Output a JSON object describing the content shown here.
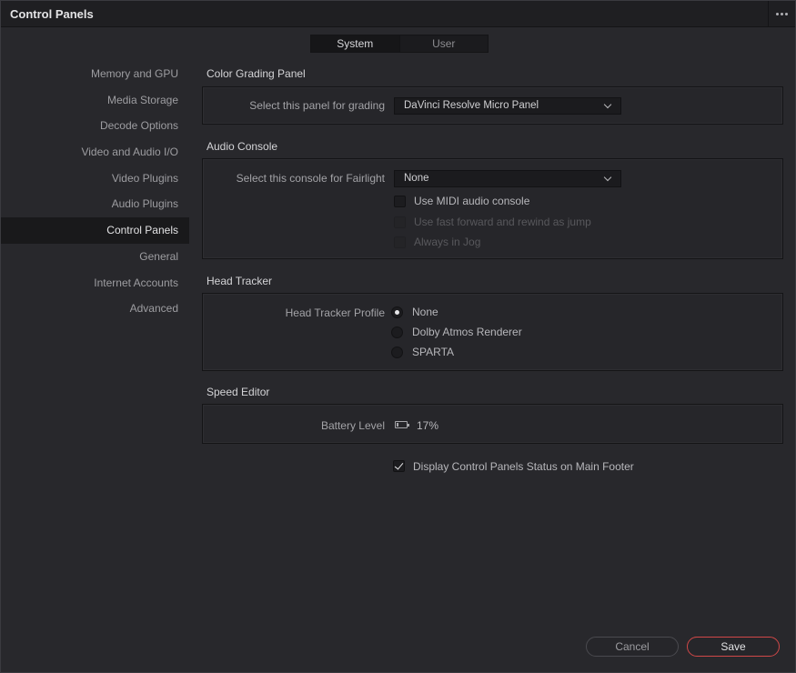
{
  "window": {
    "title": "Control Panels"
  },
  "tabs": [
    {
      "label": "System",
      "active": true
    },
    {
      "label": "User",
      "active": false
    }
  ],
  "sidebar": {
    "items": [
      {
        "label": "Memory and GPU"
      },
      {
        "label": "Media Storage"
      },
      {
        "label": "Decode Options"
      },
      {
        "label": "Video and Audio I/O"
      },
      {
        "label": "Video Plugins"
      },
      {
        "label": "Audio Plugins"
      },
      {
        "label": "Control Panels",
        "active": true
      },
      {
        "label": "General"
      },
      {
        "label": "Internet Accounts"
      },
      {
        "label": "Advanced"
      }
    ]
  },
  "color_grading": {
    "title": "Color Grading Panel",
    "select_label": "Select this panel for grading",
    "select_value": "DaVinci Resolve Micro Panel"
  },
  "audio_console": {
    "title": "Audio Console",
    "select_label": "Select this console for Fairlight",
    "select_value": "None",
    "options": [
      {
        "label": "Use MIDI audio console",
        "checked": false,
        "disabled": false
      },
      {
        "label": "Use fast forward and rewind as jump",
        "checked": false,
        "disabled": true
      },
      {
        "label": "Always in Jog",
        "checked": false,
        "disabled": true
      }
    ]
  },
  "head_tracker": {
    "title": "Head Tracker",
    "profile_label": "Head Tracker Profile",
    "profiles": [
      {
        "label": "None",
        "selected": true
      },
      {
        "label": "Dolby Atmos Renderer",
        "selected": false
      },
      {
        "label": "SPARTA",
        "selected": false
      }
    ]
  },
  "speed_editor": {
    "title": "Speed Editor",
    "battery_label": "Battery Level",
    "battery_value": "17%",
    "battery_fraction": 0.17
  },
  "footer_option": {
    "label": "Display Control Panels Status on Main Footer",
    "checked": true
  },
  "buttons": {
    "cancel": "Cancel",
    "save": "Save"
  },
  "colors": {
    "save_accent": "#d04848",
    "background": "#28282c"
  }
}
